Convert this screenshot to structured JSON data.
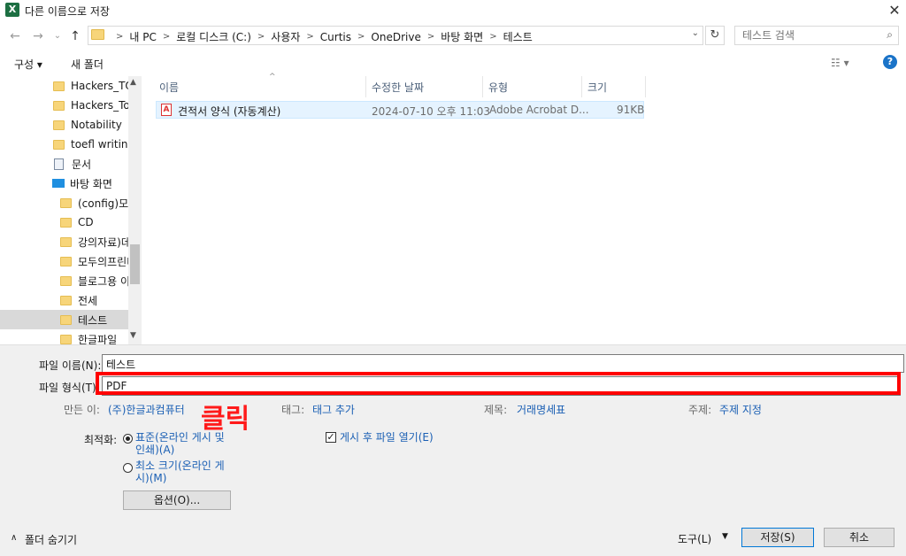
{
  "window": {
    "app_icon_letter": "X",
    "title": "다른 이름으로 저장",
    "close_glyph": "✕"
  },
  "nav_buttons": {
    "back": "←",
    "forward": "→",
    "recent": "⌄",
    "up": "↑"
  },
  "address": {
    "crumbs": [
      "내 PC",
      "로컬 디스크 (C:)",
      "사용자",
      "Curtis",
      "OneDrive",
      "바탕 화면",
      "테스트"
    ],
    "separator": ">",
    "dropdown": "⌄",
    "refresh": "↻"
  },
  "search": {
    "placeholder": "테스트 검색",
    "icon": "⌕"
  },
  "toolbar": {
    "organize": "구성 ▾",
    "new_folder": "새 폴더",
    "view_icon": "☷ ▾",
    "help": "?"
  },
  "nav_pane": {
    "items": [
      {
        "label": "Hackers_TOEFL",
        "icon": "folder",
        "indent": 1
      },
      {
        "label": "Hackers_Toefl",
        "icon": "folder",
        "indent": 1
      },
      {
        "label": "Notability",
        "icon": "folder",
        "indent": 1
      },
      {
        "label": "toefl writing",
        "icon": "folder",
        "indent": 1
      },
      {
        "label": "문서",
        "icon": "document",
        "indent": 1
      },
      {
        "label": "바탕 화면",
        "icon": "desktop",
        "indent": 1
      },
      {
        "label": "(config)모두",
        "icon": "folder",
        "indent": 2
      },
      {
        "label": "CD",
        "icon": "folder",
        "indent": 2
      },
      {
        "label": "강의자료)데",
        "icon": "folder",
        "indent": 2
      },
      {
        "label": "모두의프린터",
        "icon": "folder",
        "indent": 2
      },
      {
        "label": "블로그용 이",
        "icon": "folder",
        "indent": 2
      },
      {
        "label": "전세",
        "icon": "folder",
        "indent": 2
      },
      {
        "label": "테스트",
        "icon": "folder",
        "indent": 2,
        "selected": true
      },
      {
        "label": "한글파일",
        "icon": "folder",
        "indent": 2
      }
    ],
    "scroll_up": "▲",
    "scroll_down": "▼"
  },
  "file_list": {
    "columns": [
      "이름",
      "수정한 날짜",
      "유형",
      "크기"
    ],
    "sort_indicator": "^",
    "files": [
      {
        "name": "견적서 양식 (자동계산)",
        "modified": "2024-07-10 오후 11:03",
        "type": "Adobe Acrobat D...",
        "size": "91KB",
        "icon": "pdf-icon",
        "icon_glyph": "A"
      }
    ]
  },
  "save_form": {
    "filename_label": "파일 이름(N):",
    "filename_value": "테스트",
    "filetype_label": "파일 형식(T):",
    "filetype_value": "PDF",
    "annotation": "클릭",
    "author_label": "만든 이:",
    "author_value": "(주)한글과컴퓨터",
    "tags_label": "태그:",
    "tags_value": "태그 추가",
    "title_label": "제목:",
    "title_value": "거래명세표",
    "subject_label": "주제:",
    "subject_value": "주제 지정",
    "optimize_label": "최적화:",
    "opt_standard_line1": "표준(온라인 게시 및",
    "opt_standard_line2": "인쇄)(A)",
    "opt_minimum_line1": "최소 크기(온라인 게",
    "opt_minimum_line2": "시)(M)",
    "open_after_label": "게시 후 파일 열기(E)",
    "options_button": "옵션(O)...",
    "check_glyph": "✓"
  },
  "footer": {
    "hide_folders": "폴더 숨기기",
    "hide_folders_icon": "∧",
    "tools": "도구(L)",
    "tools_arrow": "▼",
    "save": "저장(S)",
    "cancel": "취소"
  },
  "colors": {
    "highlight_border": "#ff0000",
    "link_blue": "#1a5fb4",
    "selected_row": "#e5f3ff"
  }
}
